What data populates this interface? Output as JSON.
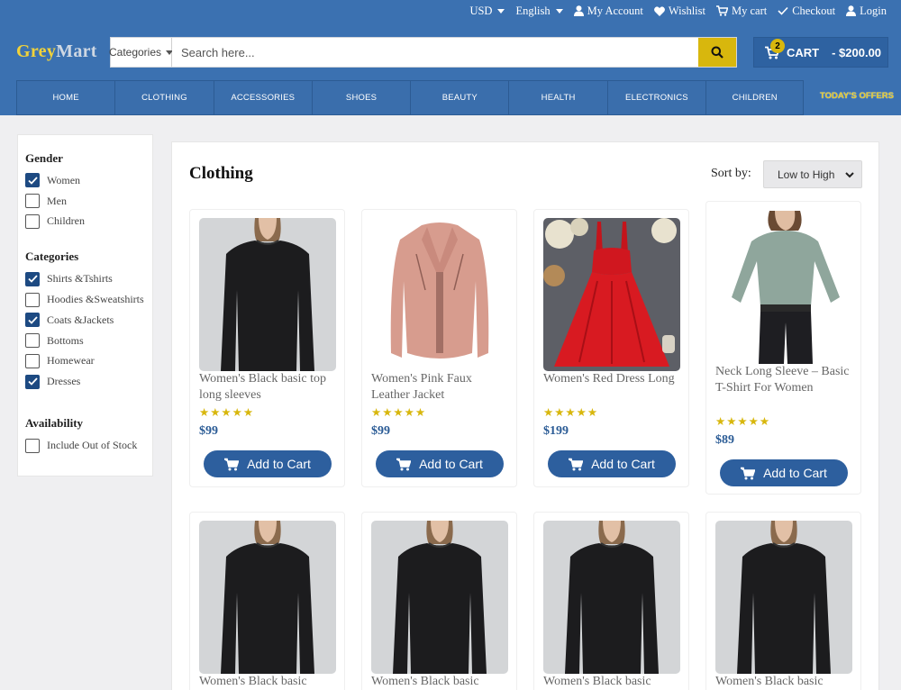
{
  "topbar": {
    "currency": "USD",
    "language": "English",
    "my_account": "My Account",
    "wishlist": "Wishlist",
    "my_cart": "My cart",
    "checkout": "Checkout",
    "login": "Login"
  },
  "logo": {
    "part1": "Grey",
    "part2": "Mart"
  },
  "search": {
    "category": "Categories",
    "placeholder": "Search here..."
  },
  "cart": {
    "count": "2",
    "label": "CART",
    "total": "- $200.00"
  },
  "nav": {
    "items": [
      "HOME",
      "CLOTHING",
      "ACCESSORIES",
      "SHOES",
      "BEAUTY",
      "HEALTH",
      "ELECTRONICS",
      "CHILDREN"
    ],
    "offers": "TODAY'S OFFERS"
  },
  "filters": {
    "gender": {
      "title": "Gender",
      "options": [
        {
          "label": "Women",
          "checked": true
        },
        {
          "label": "Men",
          "checked": false
        },
        {
          "label": "Children",
          "checked": false
        }
      ]
    },
    "categories": {
      "title": "Categories",
      "options": [
        {
          "label": "Shirts &Tshirts",
          "checked": true
        },
        {
          "label": "Hoodies &Sweatshirts",
          "checked": false
        },
        {
          "label": "Coats &Jackets",
          "checked": true
        },
        {
          "label": "Bottoms",
          "checked": false
        },
        {
          "label": "Homewear",
          "checked": false
        },
        {
          "label": "Dresses",
          "checked": true
        }
      ]
    },
    "availability": {
      "title": "Availability",
      "options": [
        {
          "label": "Include Out of Stock",
          "checked": false
        }
      ]
    }
  },
  "main": {
    "title": "Clothing",
    "sort_label": "Sort by:",
    "sort_value": "Low to High"
  },
  "products": [
    {
      "name": "Women's Black basic top long sleeves",
      "rating": "★★★★★",
      "price": "$99",
      "button": "Add to Cart",
      "image": "black-top"
    },
    {
      "name": "Women's Pink Faux Leather Jacket",
      "rating": "★★★★★",
      "price": "$99",
      "button": "Add to Cart",
      "image": "pink-jacket"
    },
    {
      "name": "Women's Red Dress Long",
      "rating": "★★★★★",
      "price": "$199",
      "button": "Add to Cart",
      "image": "red-dress"
    },
    {
      "name": "Neck Long Sleeve – Basic T-Shirt For Women",
      "rating": "★★★★★",
      "price": "$89",
      "button": "Add to Cart",
      "image": "grey-tshirt"
    },
    {
      "name": "Women's Black basic",
      "image": "black-top"
    },
    {
      "name": "Women's Black basic",
      "image": "black-top"
    },
    {
      "name": "Women's Black basic",
      "image": "black-top"
    },
    {
      "name": "Women's Black basic",
      "image": "black-top"
    }
  ],
  "colors": {
    "header": "#3b71b1",
    "accent": "#d8b70d",
    "button": "#2d5f9e",
    "price": "#2a5b95"
  }
}
